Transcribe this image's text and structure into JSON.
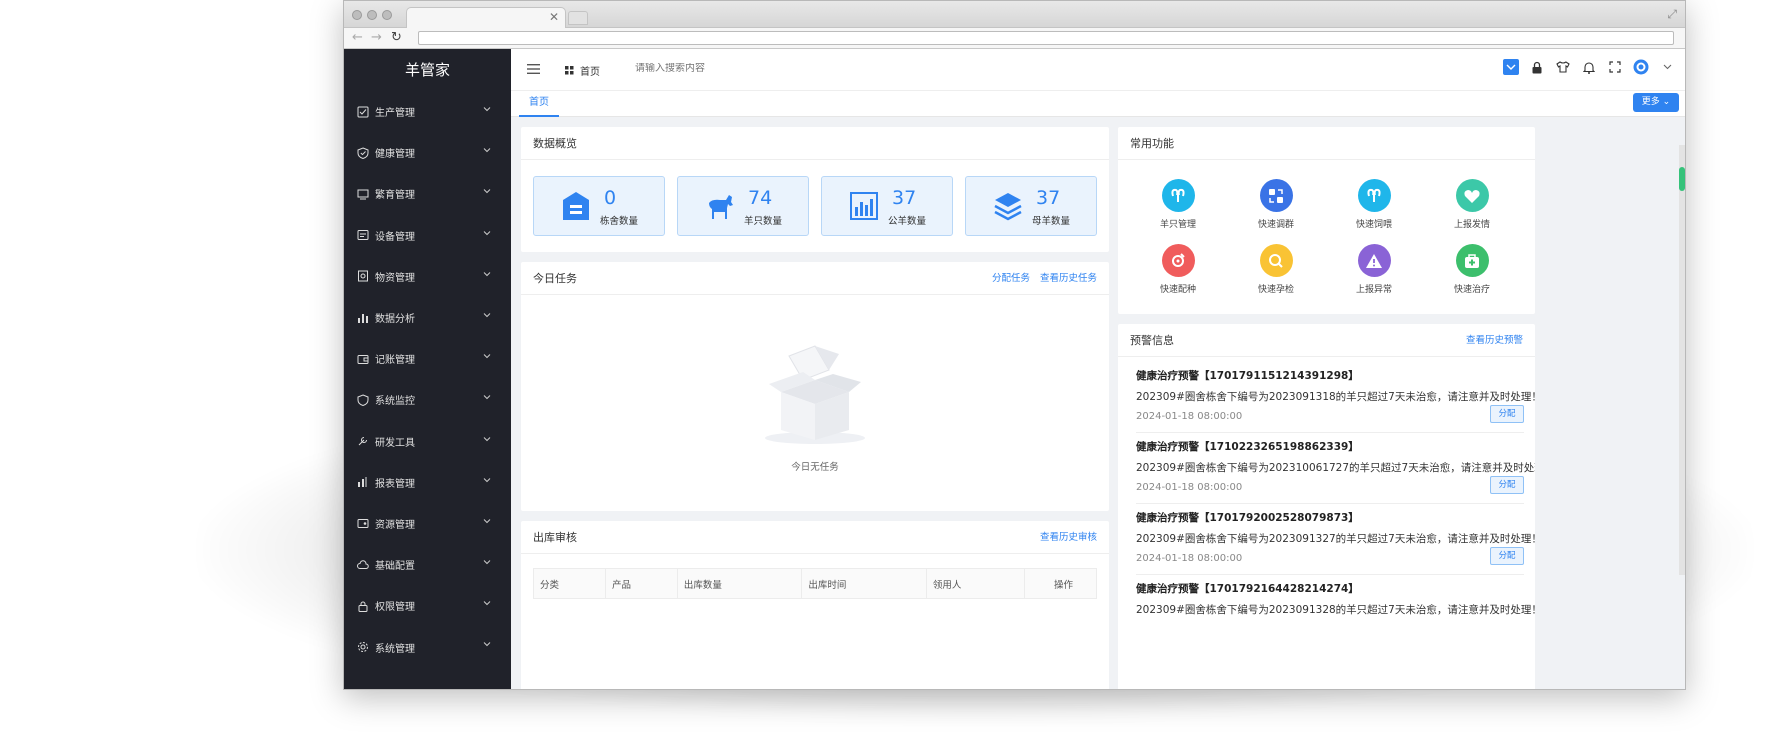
{
  "app": {
    "brand": "羊管家"
  },
  "sidebar": {
    "items": [
      {
        "label": "生产管理",
        "icon": "checkbox-icon"
      },
      {
        "label": "健康管理",
        "icon": "shield-check-icon"
      },
      {
        "label": "繁育管理",
        "icon": "breeding-icon"
      },
      {
        "label": "设备管理",
        "icon": "device-icon"
      },
      {
        "label": "物资管理",
        "icon": "materials-icon"
      },
      {
        "label": "数据分析",
        "icon": "bar-chart-icon"
      },
      {
        "label": "记账管理",
        "icon": "wallet-icon"
      },
      {
        "label": "系统监控",
        "icon": "shield-icon"
      },
      {
        "label": "研发工具",
        "icon": "tools-icon"
      },
      {
        "label": "报表管理",
        "icon": "report-icon"
      },
      {
        "label": "资源管理",
        "icon": "resource-icon"
      },
      {
        "label": "基础配置",
        "icon": "cloud-icon"
      },
      {
        "label": "权限管理",
        "icon": "lock-icon"
      },
      {
        "label": "系统管理",
        "icon": "gear-icon"
      }
    ]
  },
  "topbar": {
    "home_label": "首页",
    "search_placeholder": "请输入搜索内容"
  },
  "tabs": {
    "active": "首页",
    "more_label": "更多"
  },
  "overview": {
    "title": "数据概览",
    "stats": [
      {
        "value": "0",
        "label": "栋舍数量",
        "icon": "barn-icon"
      },
      {
        "value": "74",
        "label": "羊只数量",
        "icon": "goat-icon"
      },
      {
        "value": "37",
        "label": "公羊数量",
        "icon": "chart-icon"
      },
      {
        "value": "37",
        "label": "母羊数量",
        "icon": "layers-icon"
      }
    ]
  },
  "tasks": {
    "title": "今日任务",
    "link_assign": "分配任务",
    "link_history": "查看历史任务",
    "empty_text": "今日无任务"
  },
  "outbound": {
    "title": "出库审核",
    "link_history": "查看历史审核",
    "columns": [
      "分类",
      "产品",
      "出库数量",
      "出库时间",
      "领用人",
      "操作"
    ]
  },
  "functions": {
    "title": "常用功能",
    "items": [
      {
        "label": "羊只管理",
        "color": "#1fb6ea",
        "icon": "ram-icon"
      },
      {
        "label": "快速调群",
        "color": "#3a73e6",
        "icon": "swap-icon"
      },
      {
        "label": "快速饲喂",
        "color": "#1fb6ea",
        "icon": "ram-icon"
      },
      {
        "label": "上报发情",
        "color": "#3cc8a8",
        "icon": "heart-icon"
      },
      {
        "label": "快速配种",
        "color": "#f05c5c",
        "icon": "breed-icon"
      },
      {
        "label": "快速孕检",
        "color": "#f9c334",
        "icon": "search-icon"
      },
      {
        "label": "上报异常",
        "color": "#8a63d6",
        "icon": "warning-icon"
      },
      {
        "label": "快速治疗",
        "color": "#3cbf6c",
        "icon": "medkit-icon"
      }
    ]
  },
  "warnings": {
    "title": "预警信息",
    "link_history": "查看历史预警",
    "assign_label": "分配",
    "items": [
      {
        "title": "健康治疗预警【1701791151214391298】",
        "body": "202309#圈舍栋舍下编号为2023091318的羊只超过7天未治愈，请注意并及时处理！",
        "time": "2024-01-18 08:00:00"
      },
      {
        "title": "健康治疗预警【1710223265198862339】",
        "body": "202309#圈舍栋舍下编号为202310061727的羊只超过7天未治愈，请注意并及时处理！",
        "time": "2024-01-18 08:00:00"
      },
      {
        "title": "健康治疗预警【1701792002528079873】",
        "body": "202309#圈舍栋舍下编号为2023091327的羊只超过7天未治愈，请注意并及时处理！",
        "time": "2024-01-18 08:00:00"
      },
      {
        "title": "健康治疗预警【1701792164428214274】",
        "body": "202309#圈舍栋舍下编号为2023091328的羊只超过7天未治愈，请注意并及时处理！",
        "time": ""
      }
    ]
  }
}
